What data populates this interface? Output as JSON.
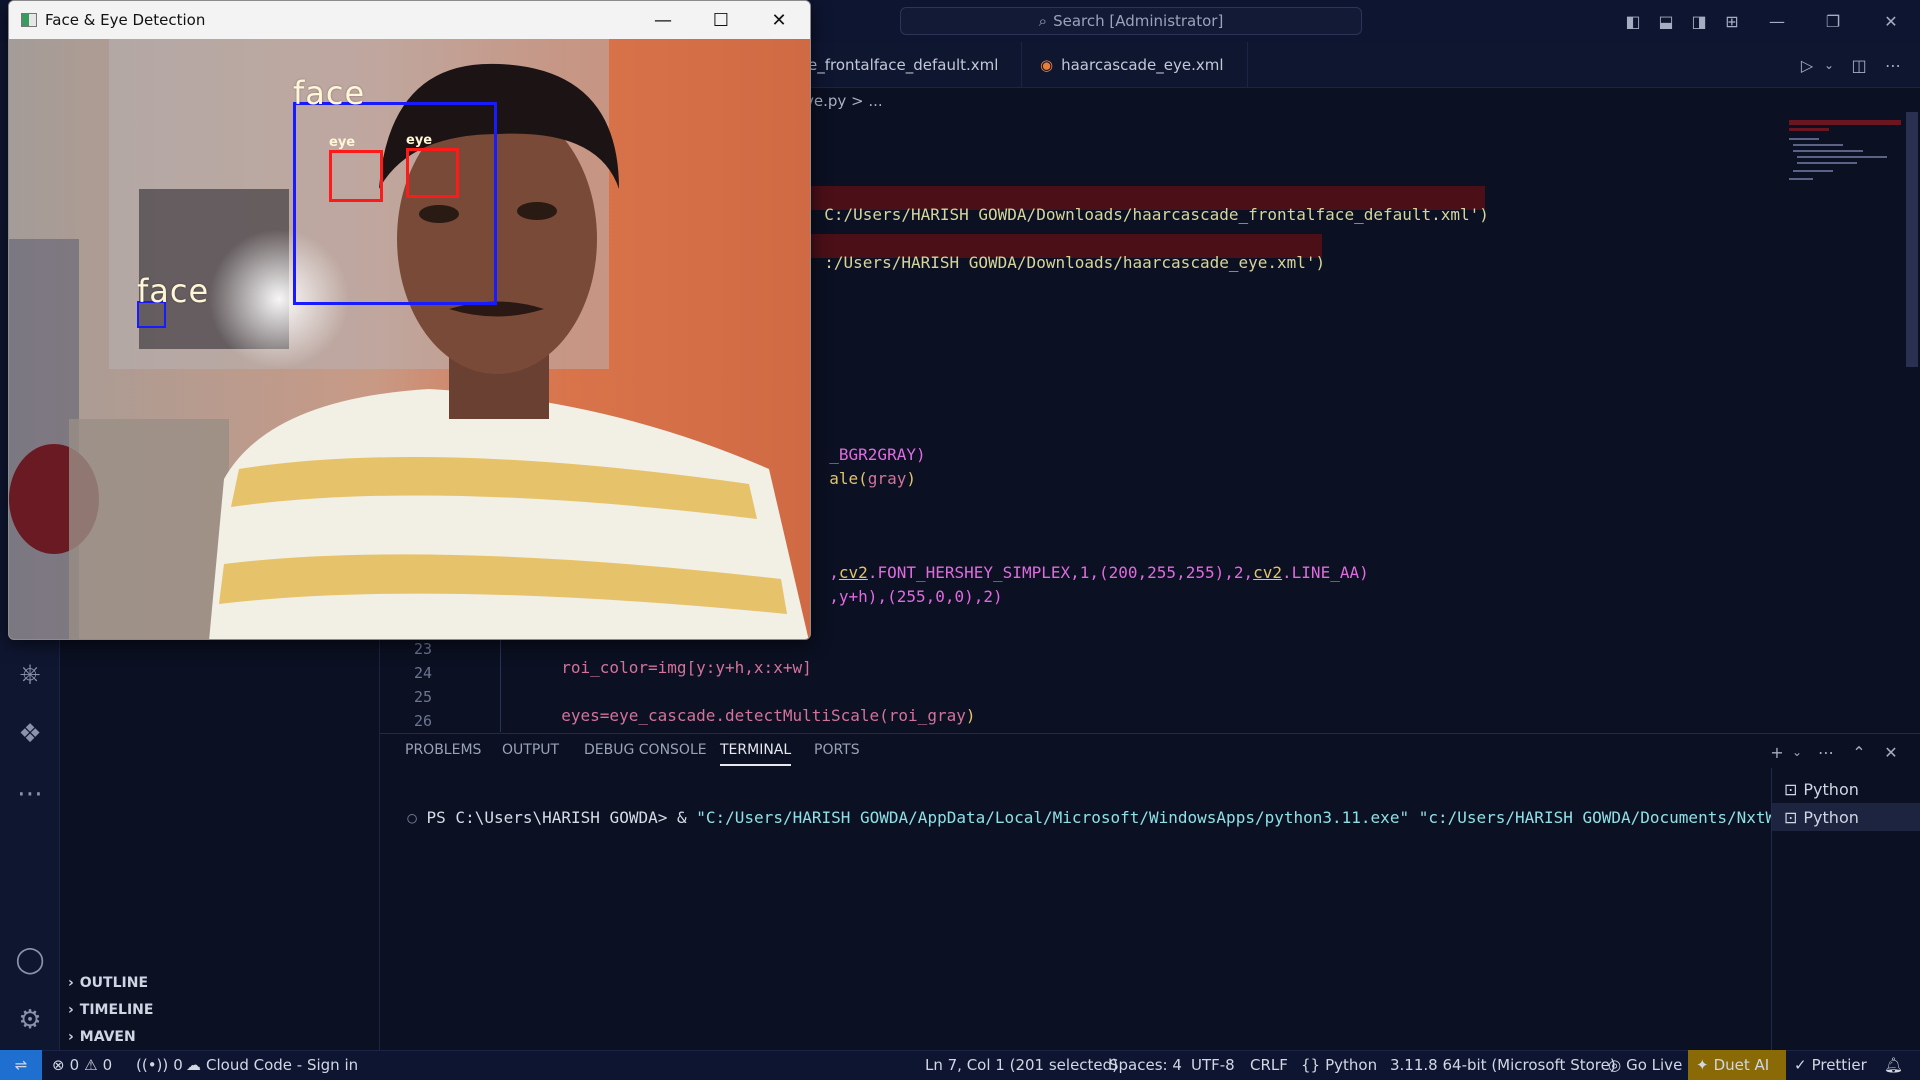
{
  "titlebar": {
    "search_text": "Search [Administrator]"
  },
  "tabs": [
    {
      "label": "e_frontalface_default.xml"
    },
    {
      "label": "haarcascade_eye.xml"
    }
  ],
  "breadcrumb": "ve.py > ...",
  "editor": {
    "frag_face_path": "C:/Users/HARISH GOWDA/Downloads/haarcascade_frontalface_default.xml')",
    "frag_eye_path": ":/Users/HARISH GOWDA/Downloads/haarcascade_eye.xml')",
    "frag_gray": "_BGR2GRAY)",
    "frag_detect_a": "ale(",
    "frag_detect_b": "gray",
    "frag_detect_c": ")",
    "frag_put_a": ",",
    "frag_put_cv2a": "cv2",
    "frag_put_b": ".FONT_HERSHEY_SIMPLEX,1,(200,255,255),2,",
    "frag_put_cv2b": "cv2",
    "frag_put_c": ".LINE_AA)",
    "frag_rect": ",y+h),(255,0,0),2)",
    "line23_num": "23",
    "line23_code": "roi_color=img[y:y+h,x:x+w]",
    "line24_num": "24",
    "line25_num": "25",
    "line25_code_a": "eyes=eye_cascade.detectMultiScale(",
    "line25_code_b": "roi_gray",
    "line25_code_c": ")",
    "line26_num": "26"
  },
  "panel": {
    "tabs": [
      "PROBLEMS",
      "OUTPUT",
      "DEBUG CONSOLE",
      "TERMINAL",
      "PORTS"
    ],
    "active_tab": "TERMINAL",
    "terminal_prompt": "PS C:\\Users\\HARISH GOWDA> & ",
    "terminal_exe": "\"C:/Users/HARISH GOWDA/AppData/Local/Microsoft/WindowsApps/python3.11.exe\"",
    "terminal_script": " \"c:/Users/HARISH GOWDA/Documents/NxtWave.py\"",
    "terminals": [
      "Python",
      "Python"
    ]
  },
  "sidebar": {
    "sections": [
      "OUTLINE",
      "TIMELINE",
      "MAVEN"
    ]
  },
  "statusbar": {
    "errors": "0",
    "warnings": "0",
    "ports": "0",
    "cloud_code": "Cloud Code - Sign in",
    "cursor": "Ln 7, Col 1 (201 selected)",
    "spaces": "Spaces: 4",
    "encoding": "UTF-8",
    "eol": "CRLF",
    "language": "Python",
    "interpreter": "3.11.8 64-bit (Microsoft Store)",
    "go_live": "Go Live",
    "duet": "Duet AI",
    "prettier": "Prettier"
  },
  "cv_window": {
    "title": "Face & Eye Detection",
    "labels": {
      "face_main": "face",
      "face_small": "face",
      "eye_left": "eye",
      "eye_right": "eye"
    },
    "colors": {
      "face_box": "#1a1aff",
      "eye_box": "#ff1a1a"
    }
  }
}
